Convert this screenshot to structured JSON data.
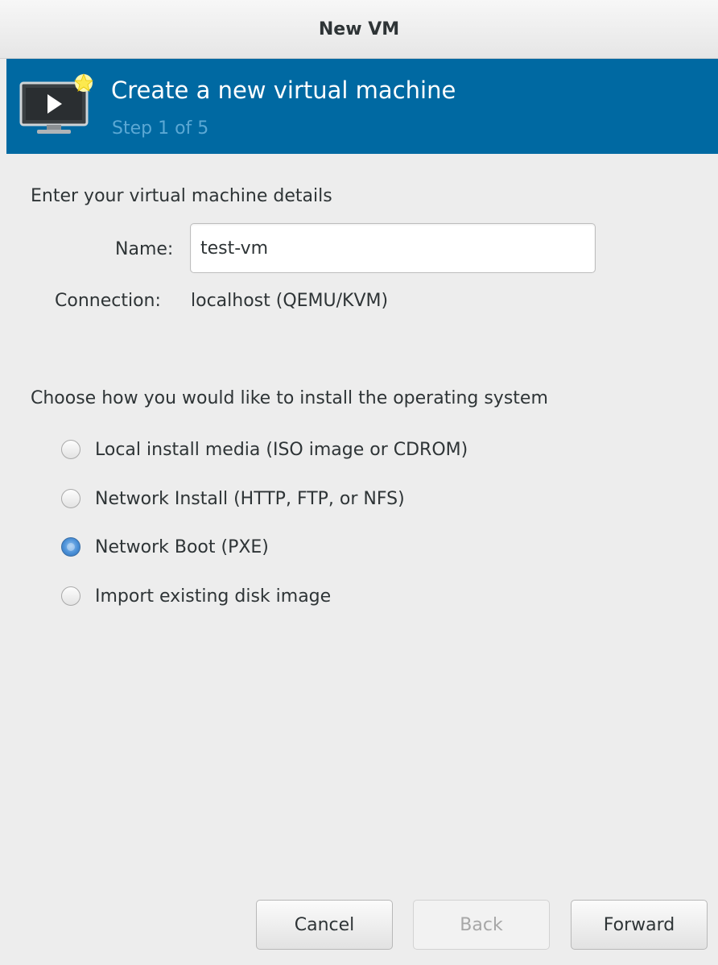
{
  "window": {
    "title": "New VM"
  },
  "banner": {
    "icon": "vm-monitor-icon",
    "title": "Create a new virtual machine",
    "step": "Step 1 of 5",
    "bg_color": "#0069a2"
  },
  "details": {
    "heading": "Enter your virtual machine details",
    "name_label": "Name:",
    "name_value": "test-vm",
    "connection_label": "Connection:",
    "connection_value": "localhost (QEMU/KVM)"
  },
  "install": {
    "heading": "Choose how you would like to install the operating system",
    "options": [
      {
        "label": "Local install media (ISO image or CDROM)",
        "selected": false
      },
      {
        "label": "Network Install (HTTP, FTP, or NFS)",
        "selected": false
      },
      {
        "label": "Network Boot (PXE)",
        "selected": true
      },
      {
        "label": "Import existing disk image",
        "selected": false
      }
    ]
  },
  "buttons": {
    "cancel": "Cancel",
    "back": "Back",
    "back_enabled": false,
    "forward": "Forward"
  }
}
